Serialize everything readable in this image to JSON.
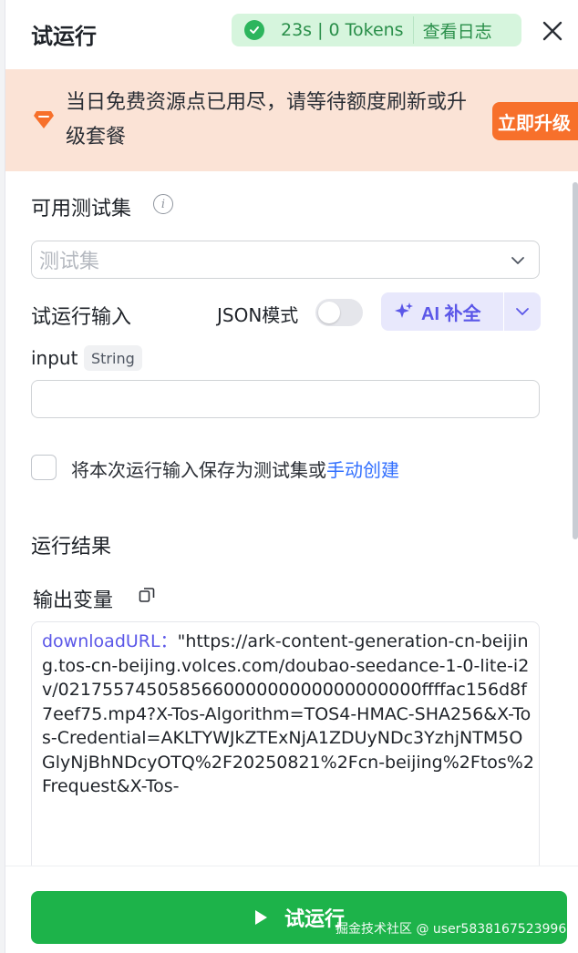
{
  "header": {
    "title": "试运行",
    "status_time": "23s",
    "status_tokens": "0 Tokens",
    "view_log": "查看日志"
  },
  "banner": {
    "message": "当日免费资源点已用尽，请等待额度刷新或升级套餐",
    "upgrade_label": "立即升级"
  },
  "test_set": {
    "label": "可用测试集",
    "placeholder": "测试集"
  },
  "run_input": {
    "label": "试运行输入",
    "json_mode_label": "JSON模式",
    "json_mode_on": false,
    "ai_fill_label": "AI 补全"
  },
  "input_field": {
    "name": "input",
    "type": "String",
    "value": ""
  },
  "save_option": {
    "text": "将本次运行输入保存为测试集或",
    "link": "手动创建",
    "checked": false
  },
  "result": {
    "section_label": "运行结果",
    "output_label": "输出变量",
    "var_name": "downloadURL：",
    "var_value": "\"https://ark-content-generation-cn-beijing.tos-cn-beijing.volces.com/doubao-seedance-1-0-lite-i2v/021755745058566000000000000000000ffffac156d8f7eef75.mp4?X-Tos-Algorithm=TOS4-HMAC-SHA256&X-Tos-Credential=AKLTYWJkZTExNjA1ZDUyNDc3YzhjNTM5OGlyNjBhNDcyOTQ%2F20250821%2Fcn-beijing%2Ftos%2Frequest&X-Tos-"
  },
  "footer": {
    "run_label": "试运行",
    "watermark": "掘金技术社区 @ user5838167523996"
  },
  "colors": {
    "accent_green": "#1db34a",
    "banner_bg": "#fbe3d6",
    "upgrade_orange": "#f7702b",
    "ai_purple": "#5b57e8",
    "link_blue": "#3370ff"
  }
}
